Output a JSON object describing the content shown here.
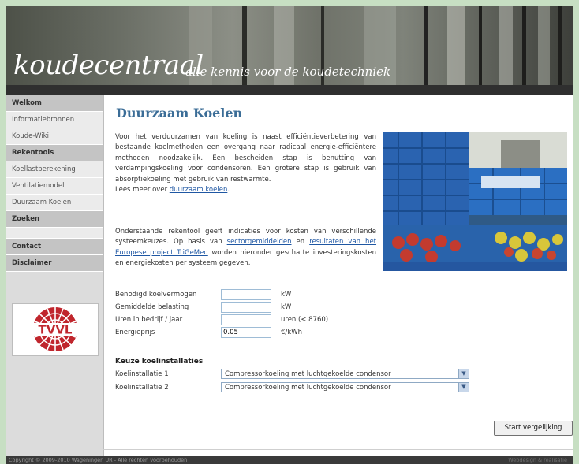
{
  "header": {
    "logo": "koudecentraal",
    "tagline": "alle kennis voor de koudetechniek"
  },
  "sidebar": {
    "items": [
      {
        "label": "Welkom",
        "kind": "head"
      },
      {
        "label": "Informatiebronnen",
        "kind": "item"
      },
      {
        "label": "Koude-Wiki",
        "kind": "item"
      },
      {
        "label": "Rekentools",
        "kind": "head"
      },
      {
        "label": "Koellastberekening",
        "kind": "item"
      },
      {
        "label": "Ventilatiemodel",
        "kind": "item"
      },
      {
        "label": "Duurzaam Koelen",
        "kind": "item"
      },
      {
        "label": "Zoeken",
        "kind": "head"
      },
      {
        "label": "Contact",
        "kind": "head"
      },
      {
        "label": "Disclaimer",
        "kind": "head"
      }
    ],
    "logo_text": "TVVL"
  },
  "main": {
    "title": "Duurzaam Koelen",
    "para1": "Voor het verduurzamen van koeling is naast efficiëntieverbetering van bestaande koelmethoden een overgang naar radicaal energie-efficiëntere methoden noodzakelijk. Een bescheiden stap is benutting van verdampingskoeling voor condensoren. Een grotere stap is gebruik van absorptiekoeling met gebruik van restwarmte.",
    "read_more_prefix": "Lees meer over ",
    "read_more_link": "duurzaam koelen",
    "read_more_suffix": ".",
    "para2_a": "Onderstaande rekentool geeft indicaties voor kosten van verschillende systeemkeuzes. Op basis van ",
    "para2_link1": "sectorgemiddelden",
    "para2_b": " en ",
    "para2_link2": "resultaten van het Europese project TriGeMed",
    "para2_c": " worden hieronder geschatte investeringskosten en energiekosten per systeem gegeven.",
    "fields": [
      {
        "label": "Benodigd koelvermogen",
        "value": "",
        "unit": "kW"
      },
      {
        "label": "Gemiddelde belasting",
        "value": "",
        "unit": "kW"
      },
      {
        "label": "Uren in bedrijf / jaar",
        "value": "",
        "unit": "uren (< 8760)"
      },
      {
        "label": "Energieprijs",
        "value": "0.05",
        "unit": "€/kWh"
      }
    ],
    "keuze_title": "Keuze koelinstallaties",
    "installations": [
      {
        "label": "Koelinstallatie 1",
        "selected": "Compressorkoeling met luchtgekoelde condensor"
      },
      {
        "label": "Koelinstallatie 2",
        "selected": "Compressorkoeling met luchtgekoelde condensor"
      }
    ],
    "start_button": "Start vergelijking"
  },
  "footer": {
    "copyright": "Copyright © 2009-2010 Wageningen UR - Alle rechten voorbehouden",
    "right": "Webdesign & realisatie"
  },
  "colors": {
    "background": "#c7dfc3",
    "title": "#3b6d97",
    "link": "#1f57a3",
    "nav_head": "#c4c4c4",
    "footer": "#3a3a3a"
  }
}
